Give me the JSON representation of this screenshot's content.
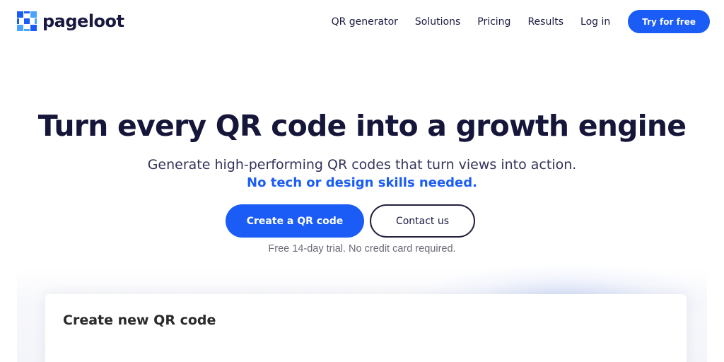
{
  "brand": {
    "name": "pageloot",
    "logo_icon": "pageloot-logo-icon",
    "colors": {
      "primary": "#1a5cf5",
      "dark": "#16163a",
      "muted": "#6b6b78"
    }
  },
  "nav": {
    "items": [
      {
        "label": "QR generator"
      },
      {
        "label": "Solutions"
      },
      {
        "label": "Pricing"
      },
      {
        "label": "Results"
      },
      {
        "label": "Log in"
      }
    ],
    "cta_label": "Try for free"
  },
  "hero": {
    "title": "Turn every QR code into a growth engine",
    "subtitle": "Generate high-performing QR codes that turn views into action.",
    "accent": "No tech or design skills needed.",
    "primary_button": "Create a QR code",
    "secondary_button": "Contact us",
    "trial_note": "Free 14-day trial. No credit card required."
  },
  "card": {
    "title": "Create new QR code"
  }
}
